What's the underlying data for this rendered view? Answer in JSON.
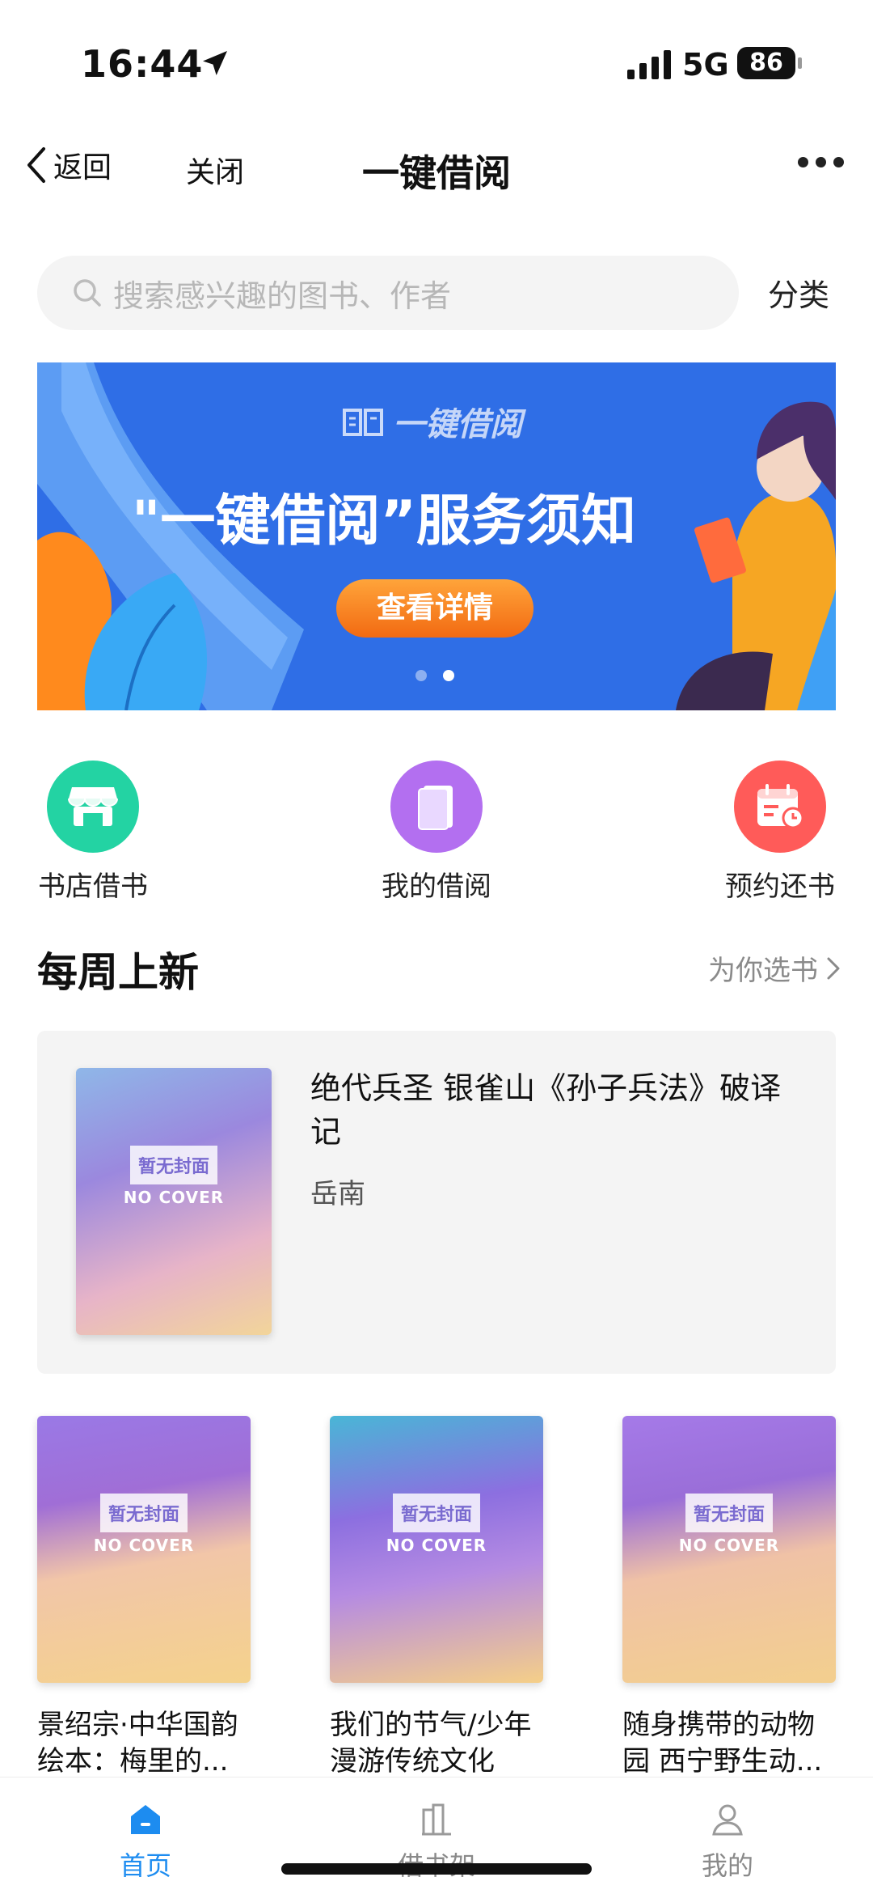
{
  "status_bar": {
    "time": "16:44",
    "network": "5G",
    "battery": "86"
  },
  "nav": {
    "back_label": "返回",
    "close_label": "关闭",
    "title": "一键借阅"
  },
  "search": {
    "placeholder": "搜索感兴趣的图书、作者",
    "category_label": "分类"
  },
  "banner": {
    "logo_text": "一键借阅",
    "headline": "\"一键借阅”服务须知",
    "cta_label": "查看详情",
    "page_count": 2,
    "active_page": 2
  },
  "quick_actions": [
    {
      "label": "书店借书",
      "icon": "store-icon",
      "color": "#23d3a3"
    },
    {
      "label": "我的借阅",
      "icon": "book-icon",
      "color": "#b36ff0"
    },
    {
      "label": "预约还书",
      "icon": "calendar-clock-icon",
      "color": "#ff5b59"
    }
  ],
  "weekly_new": {
    "title": "每周上新",
    "more_label": "为你选书",
    "featured": {
      "title": "绝代兵圣 银雀山《孙子兵法》破译记",
      "author": "岳南",
      "cover_tag": "暂无封面",
      "cover_sub": "NO COVER"
    },
    "books": [
      {
        "title": "景绍宗·中华国韵绘本：梅里的...",
        "cover_tag": "暂无封面",
        "cover_sub": "NO COVER"
      },
      {
        "title": "我们的节气/少年漫游传统文化",
        "cover_tag": "暂无封面",
        "cover_sub": "NO COVER"
      },
      {
        "title": "随身携带的动物园 西宁野生动...",
        "cover_tag": "暂无封面",
        "cover_sub": "NO COVER"
      }
    ]
  },
  "tab_bar": {
    "tabs": [
      {
        "label": "首页",
        "icon": "home-icon",
        "active": true
      },
      {
        "label": "借书架",
        "icon": "bookshelf-icon",
        "active": false
      },
      {
        "label": "我的",
        "icon": "user-icon",
        "active": false
      }
    ]
  },
  "colors": {
    "accent": "#1d8cf0",
    "banner_bg": "#2f6ee6",
    "cta_orange": "#f26a12"
  }
}
